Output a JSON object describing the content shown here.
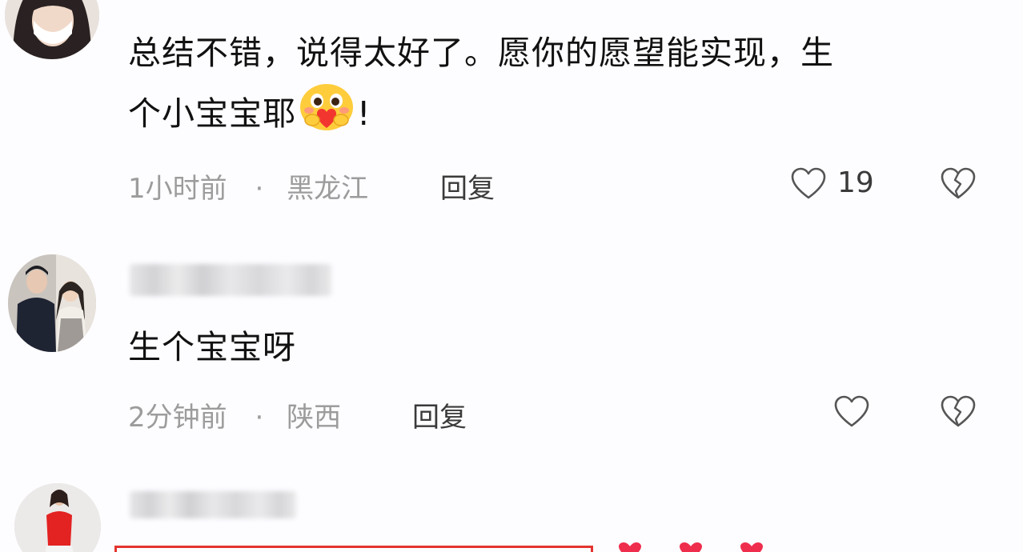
{
  "comments": [
    {
      "id": "c1",
      "text_line1": "总结不错，说得太好了。愿你的愿望能实现，生",
      "text_line2_before": "个小宝宝耶",
      "text_line2_after": "!",
      "emoji_icon": "hugging-heart-emoji",
      "time": "1小时前",
      "separator": "·",
      "location": "黑龙江",
      "reply_label": "回复",
      "like_count": "19"
    },
    {
      "id": "c2",
      "text": "生个宝宝呀",
      "time": "2分钟前",
      "separator": "·",
      "location": "陕西",
      "reply_label": "回复",
      "like_count": ""
    }
  ],
  "icons": {
    "like": "heart-outline-icon",
    "dislike": "broken-heart-icon"
  },
  "colors": {
    "text": "#111111",
    "meta": "#9c9c9c",
    "accent_red": "#e3342f"
  }
}
